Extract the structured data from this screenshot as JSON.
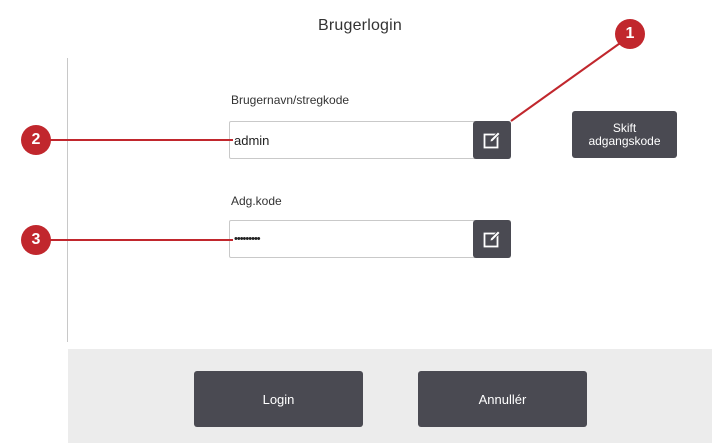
{
  "dialog": {
    "title": "Brugerlogin"
  },
  "username": {
    "label": "Brugernavn/stregkode",
    "value": "admin",
    "edit_icon": "edit-icon"
  },
  "password": {
    "label": "Adg.kode",
    "value": "•••••••••",
    "edit_icon": "edit-icon"
  },
  "change_password_button": {
    "label": "Skift\nadgangskode"
  },
  "footer": {
    "login_label": "Login",
    "cancel_label": "Annullér"
  },
  "callouts": [
    {
      "number": "1"
    },
    {
      "number": "2"
    },
    {
      "number": "3"
    }
  ],
  "colors": {
    "button": "#4a4a52",
    "callout": "#c1272d",
    "footer_bg": "#ececec"
  }
}
